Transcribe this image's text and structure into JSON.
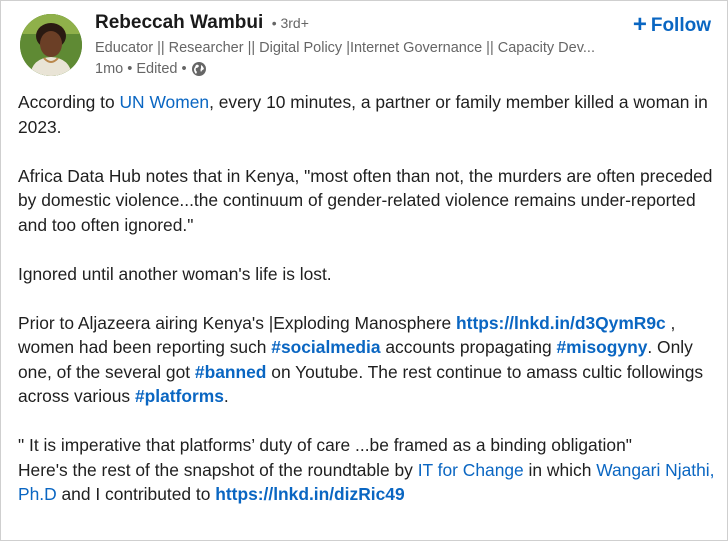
{
  "author": {
    "name": "Rebeccah Wambui",
    "degree": "• 3rd+",
    "headline": "Educator || Researcher || Digital Policy |Internet Governance || Capacity Dev...",
    "meta": "1mo • Edited •",
    "follow_label": "Follow",
    "follow_plus": "+"
  },
  "accent_color": "#0a66c2",
  "icons": {
    "visibility": "globe-icon"
  },
  "post": {
    "p1": {
      "a": "According to ",
      "link": "UN Women",
      "b": ", every 10 minutes, a partner or family member killed a woman in 2023."
    },
    "p2": "Africa Data Hub notes that in Kenya, \"most often than not, the murders are often preceded by domestic violence...the continuum of gender-related violence remains under-reported and too often ignored.\"",
    "p3": "Ignored until another woman's life is lost.",
    "p4": {
      "a": "Prior to Aljazeera airing Kenya's |Exploding Manosphere ",
      "url1": "https://lnkd.in/d3QymR9c",
      "b": " , women had been reporting such ",
      "tag1": "#socialmedia",
      "c": " accounts propagating ",
      "tag2": "#misogyny",
      "d": ". Only one, of the several got ",
      "tag3": "#banned",
      "e": " on Youtube. The rest continue to amass cultic followings across various ",
      "tag4": "#platforms",
      "f": "."
    },
    "p5": {
      "a": "\" It is imperative that platforms’ duty of care ...be framed as a binding obligation\"",
      "b": "Here's the rest of the snapshot of the roundtable by ",
      "link1": "IT for Change",
      "c": " in which ",
      "link2": "Wangari Njathi, Ph.D",
      "d": " and I contributed to ",
      "url2": "https://lnkd.in/dizRic49"
    }
  }
}
